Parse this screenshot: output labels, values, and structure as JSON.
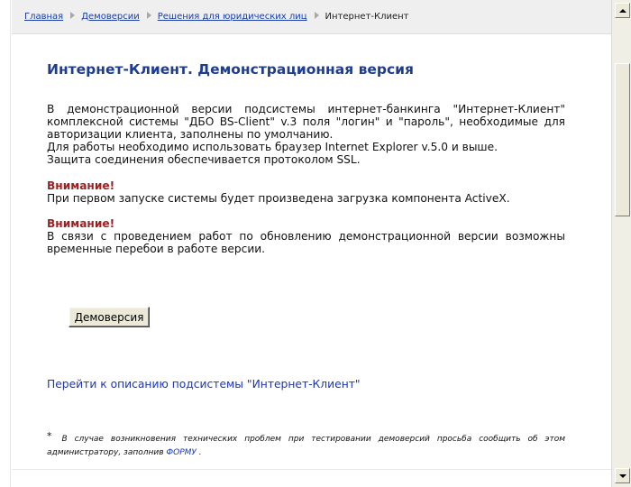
{
  "breadcrumb": {
    "items": [
      "Главная",
      "Демоверсии",
      "Решения для юридических лиц"
    ],
    "current": "Интернет-Клиент"
  },
  "main": {
    "title": "Интернет-Клиент. Демонстрационная версия",
    "intro_lines": [
      "В демонстрационной версии подсистемы интернет-банкинга \"Интернет-Клиент\" комплексной системы \"ДБО BS-Client\" v.3 поля \"логин\" и \"пароль\", необходимые для авторизации клиента, заполнены по умолчанию.",
      "Для работы необходимо использовать браузер Internet Explorer v.5.0 и выше.",
      "Защита соединения обеспечивается протоколом SSL."
    ],
    "warning1_title": "Внимание!",
    "warning1_text": "При первом запуске системы будет произведена загрузка компонента ActiveX.",
    "warning2_title": "Внимание!",
    "warning2_text": "В связи с проведением работ по обновлению демонстрационной версии возможны временные перебои в работе версии.",
    "demo_button_label": "Демоверсия",
    "description_link": "Перейти к описанию подсистемы \"Интернет-Клиент\"",
    "footnote_star": "*",
    "footnote_text": "В случае возникновения технических проблем при тестировании демоверсий просьба сообщить об этом администратору, заполнив",
    "footnote_link": "ФОРМУ",
    "footnote_end": "."
  },
  "colors": {
    "title": "#1e3d8f",
    "link": "#1a36b5",
    "warning": "#9b2222"
  }
}
